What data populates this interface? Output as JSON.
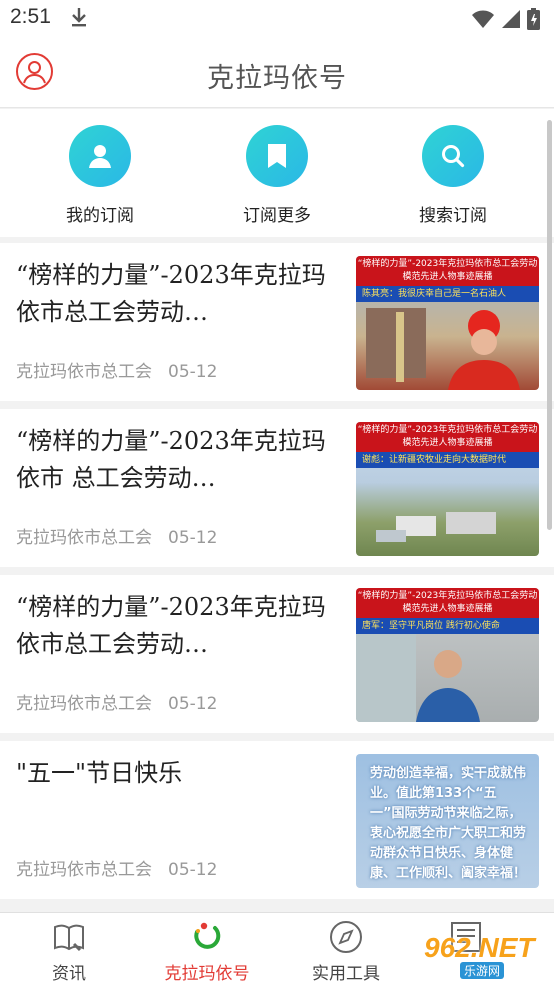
{
  "status_bar": {
    "time": "2:51"
  },
  "header": {
    "title": "克拉玛依号"
  },
  "shortcuts": [
    {
      "label": "我的订阅",
      "icon": "user-icon"
    },
    {
      "label": "订阅更多",
      "icon": "bookmark-icon"
    },
    {
      "label": "搜索订阅",
      "icon": "search-icon"
    }
  ],
  "articles": [
    {
      "title": "“榜样的力量”-2023年克拉玛依市总工会劳动…",
      "source": "克拉玛依市总工会",
      "date": "05-12",
      "thumb_banner": "“榜样的力量”-2023年克拉玛依市总工会劳动模范先进人物事迹展播",
      "thumb_caption": "陈其亮：我很庆幸自己是一名石油人"
    },
    {
      "title": "“榜样的力量”-2023年克拉玛依市 总工会劳动…",
      "source": "克拉玛依市总工会",
      "date": "05-12",
      "thumb_banner": "“榜样的力量”-2023年克拉玛依市总工会劳动模范先进人物事迹展播",
      "thumb_caption": "谢彪：让新疆农牧业走向大数据时代"
    },
    {
      "title": "“榜样的力量”-2023年克拉玛依市总工会劳动…",
      "source": "克拉玛依市总工会",
      "date": "05-12",
      "thumb_banner": "“榜样的力量”-2023年克拉玛依市总工会劳动模范先进人物事迹展播",
      "thumb_caption": "唐军：坚守平凡岗位 践行初心使命"
    },
    {
      "title": "\"五一\"节日快乐",
      "source": "克拉玛依市总工会",
      "date": "05-12",
      "thumb_text": "劳动创造幸福，实干成就伟业。值此第133个“五一”国际劳动节来临之际，衷心祝愿全市广大职工和劳动群众节日快乐、身体健康、工作顺利、阖家幸福！"
    }
  ],
  "tabs": [
    {
      "label": "资讯",
      "icon": "book-icon"
    },
    {
      "label": "克拉玛依号",
      "icon": "ring-logo-icon"
    },
    {
      "label": "实用工具",
      "icon": "compass-icon"
    },
    {
      "label": "",
      "icon": "news-icon"
    }
  ],
  "watermark": {
    "brand": "962.NET",
    "sub": "乐游网"
  },
  "colors": {
    "accent": "#e23b35",
    "teal": "#2fd3d4"
  }
}
